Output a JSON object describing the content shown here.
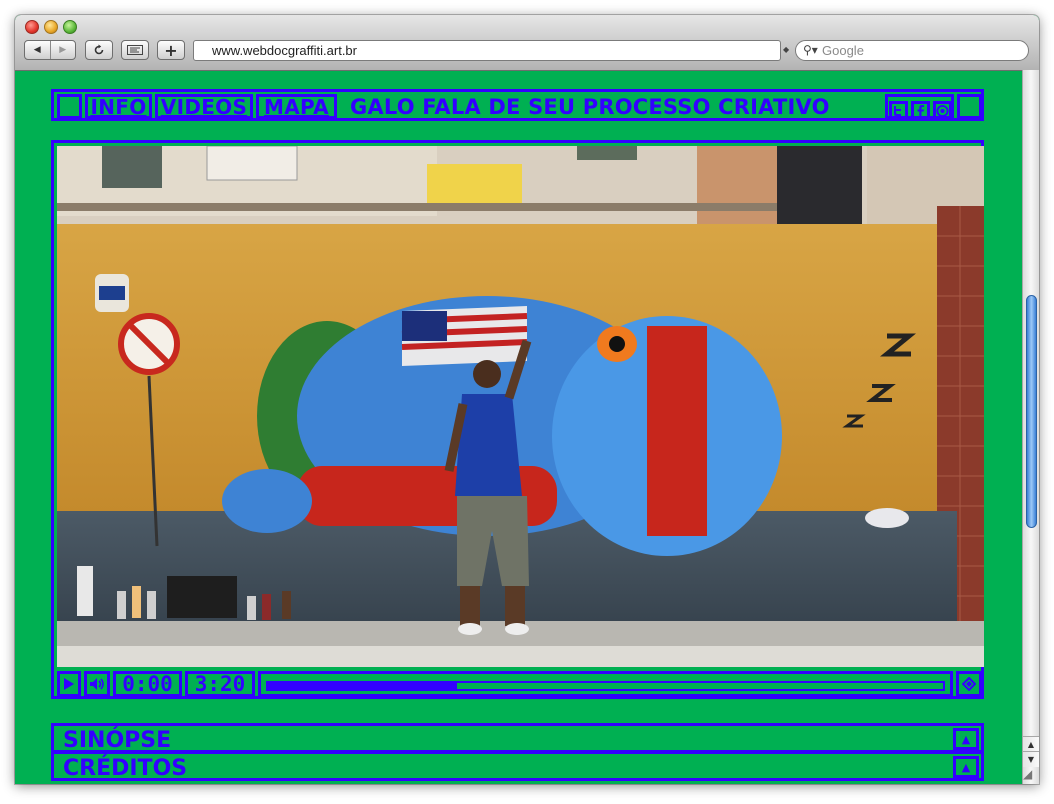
{
  "browser": {
    "url": "www.webdocgraffiti.art.br",
    "search_placeholder": "Google",
    "back_label": "◀",
    "forward_label": "▶",
    "add_tab_label": "+"
  },
  "site": {
    "nav": [
      {
        "label": "INFO"
      },
      {
        "label": "VIDEOS"
      },
      {
        "label": "MAPA"
      }
    ],
    "title": "GALO FALA DE SEU PROCESSO CRIATIVO",
    "social": [
      "twitter-icon",
      "facebook-icon",
      "camera-icon"
    ]
  },
  "player": {
    "current_time": "0:00",
    "duration": "3:20",
    "progress": 0.28
  },
  "sections": [
    {
      "label": "SINÓPSE"
    },
    {
      "label": "CRÉDITOS"
    }
  ],
  "colors": {
    "background": "#00b052",
    "accent": "#3300ff"
  }
}
